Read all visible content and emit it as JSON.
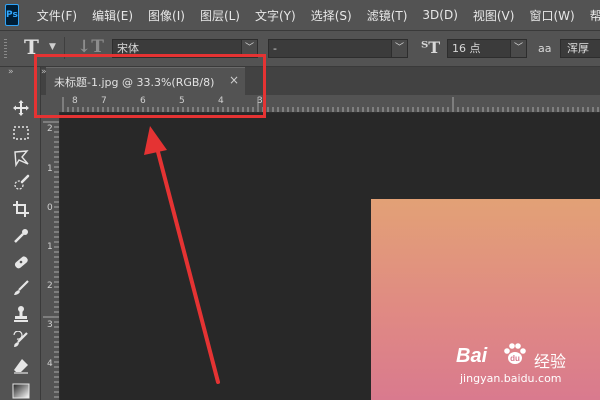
{
  "app": {
    "logo": "Ps"
  },
  "menubar": {
    "items": [
      "文件(F)",
      "编辑(E)",
      "图像(I)",
      "图层(L)",
      "文字(Y)",
      "选择(S)",
      "滤镜(T)",
      "3D(D)",
      "视图(V)",
      "窗口(W)",
      "帮助"
    ]
  },
  "options": {
    "font_family": "宋体",
    "font_style": "-",
    "font_size": "16 点",
    "antialias_icon": "aa",
    "antialias_value": "浑厚"
  },
  "document": {
    "tab_title": "未标题-1.jpg @ 33.3%(RGB/8)",
    "close_glyph": "×"
  },
  "ruler": {
    "h_labels": [
      "8",
      "7",
      "6",
      "5",
      "4",
      "3"
    ],
    "v_labels": [
      "2",
      "1",
      "0",
      "1",
      "2",
      "3",
      "4"
    ]
  },
  "toolbar": {
    "tools": [
      "move-tool-icon",
      "marquee-tool-icon",
      "lasso-tool-icon",
      "quick-select-tool-icon",
      "crop-tool-icon",
      "eyedropper-tool-icon",
      "healing-brush-tool-icon",
      "brush-tool-icon",
      "clone-stamp-tool-icon",
      "history-brush-tool-icon",
      "eraser-tool-icon",
      "gradient-tool-icon"
    ]
  },
  "annotation": {
    "color": "#e53333"
  },
  "watermark": {
    "logo": "Bai",
    "logo_suffix": "du",
    "text": "经验",
    "url": "jingyan.baidu.com"
  },
  "colors": {
    "canvas": "#282828",
    "panel": "#535353",
    "image_top": "#e2a176",
    "image_bottom": "#d97a8e"
  }
}
